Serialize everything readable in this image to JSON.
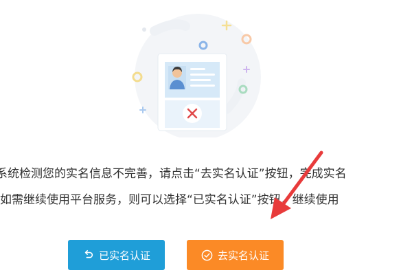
{
  "message": {
    "line1": "系统检测您的实名信息不完善，请点击“去实名认证”按钮，完成实名",
    "line2": "如需继续使用平台服务，则可以选择“已实名认证”按钮，继续使用"
  },
  "buttons": {
    "verified_label": "已实名认证",
    "verified_icon": "undo-icon",
    "go_verify_label": "去实名认证",
    "go_verify_icon": "check-circle-icon"
  },
  "colors": {
    "verified_button": "#1f9ed8",
    "go_verify_button": "#fb8a26",
    "arrow": "#e83b3b",
    "text": "#333333"
  }
}
